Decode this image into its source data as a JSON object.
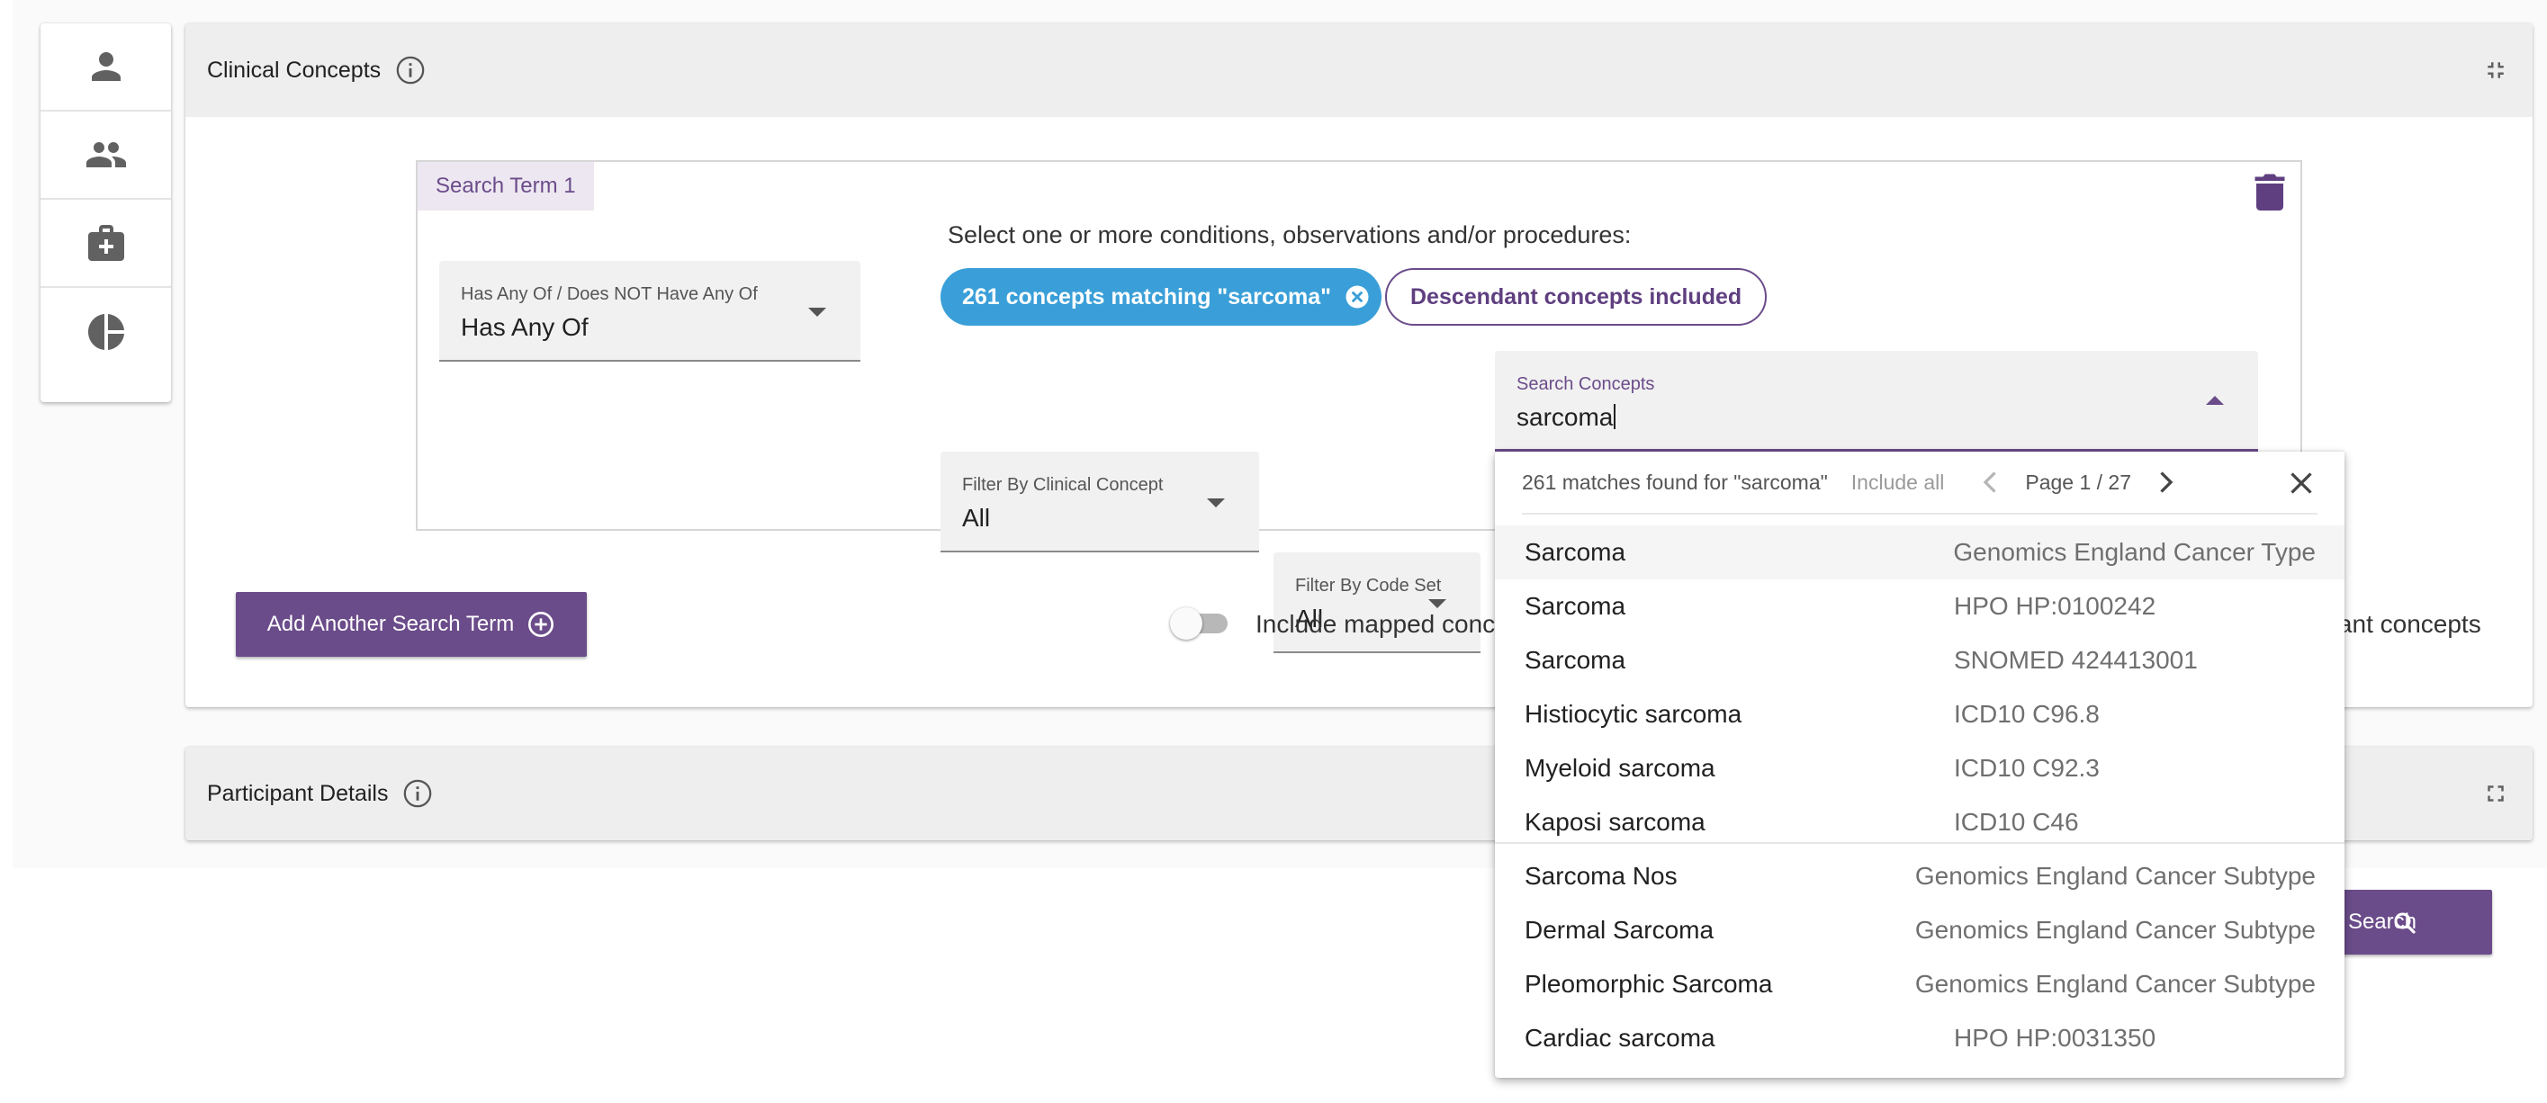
{
  "sidebar": {
    "items": [
      {
        "icon": "person-icon"
      },
      {
        "icon": "people-icon"
      },
      {
        "icon": "medical-bag-icon"
      },
      {
        "icon": "pie-chart-icon"
      }
    ]
  },
  "clinical_panel": {
    "title": "Clinical Concepts"
  },
  "search_term": {
    "label": "Search Term 1",
    "has_any": {
      "label": "Has Any Of / Does NOT Have Any Of",
      "value": "Has Any Of"
    },
    "instructions": "Select one or more conditions, observations and/or procedures:",
    "chip_match": "261 concepts matching \"sarcoma\"",
    "chip_descendant": "Descendant concepts included",
    "filter_concept": {
      "label": "Filter By Clinical Concept",
      "value": "All"
    },
    "filter_codeset": {
      "label": "Filter By Code Set",
      "value": "All"
    },
    "search": {
      "label": "Search Concepts",
      "value": "sarcoma"
    }
  },
  "actions": {
    "add_term": "Add Another Search Term",
    "include_mapped": "Include mapped concepts",
    "include_descendant": "Include descendant concepts",
    "search_button": "Search"
  },
  "participant_panel": {
    "title": "Participant Details"
  },
  "dropdown": {
    "count_text": "261 matches found for \"sarcoma\"",
    "include_all": "Include all",
    "page_text": "Page 1 / 27",
    "results": [
      {
        "name": "Sarcoma",
        "code": "Genomics England Cancer Type"
      },
      {
        "name": "Sarcoma",
        "code": "HPO HP:0100242"
      },
      {
        "name": "Sarcoma",
        "code": "SNOMED 424413001"
      },
      {
        "name": "Histiocytic sarcoma",
        "code": "ICD10 C96.8"
      },
      {
        "name": "Myeloid sarcoma",
        "code": "ICD10 C92.3"
      },
      {
        "name": "Kaposi sarcoma",
        "code": "ICD10 C46"
      },
      {
        "name": "Sarcoma Nos",
        "code": "Genomics England Cancer Subtype"
      },
      {
        "name": "Dermal Sarcoma",
        "code": "Genomics England Cancer Subtype"
      },
      {
        "name": "Pleomorphic Sarcoma",
        "code": "Genomics England Cancer Subtype"
      },
      {
        "name": "Cardiac sarcoma",
        "code": "HPO HP:0031350"
      }
    ]
  },
  "colors": {
    "primary": "#6b4c8a",
    "chip_blue": "#3a9fd8",
    "header_gray": "#eeeeee"
  }
}
